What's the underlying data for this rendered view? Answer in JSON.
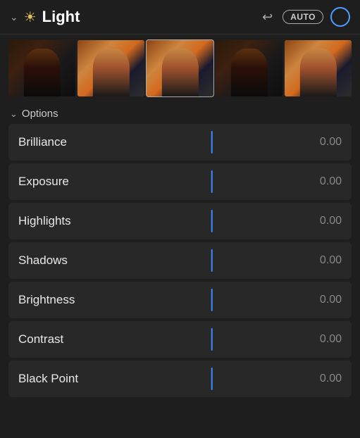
{
  "header": {
    "title": "Light",
    "auto_label": "AUTO",
    "undo_icon": "↩",
    "chevron_icon": "⌄",
    "sun_icon": "☀"
  },
  "options": {
    "label": "Options",
    "chevron": "⌄"
  },
  "sliders": [
    {
      "label": "Brilliance",
      "value": "0.00"
    },
    {
      "label": "Exposure",
      "value": "0.00"
    },
    {
      "label": "Highlights",
      "value": "0.00"
    },
    {
      "label": "Shadows",
      "value": "0.00"
    },
    {
      "label": "Brightness",
      "value": "0.00"
    },
    {
      "label": "Contrast",
      "value": "0.00"
    },
    {
      "label": "Black Point",
      "value": "0.00"
    }
  ],
  "filmstrip": {
    "frame_count": 5
  }
}
